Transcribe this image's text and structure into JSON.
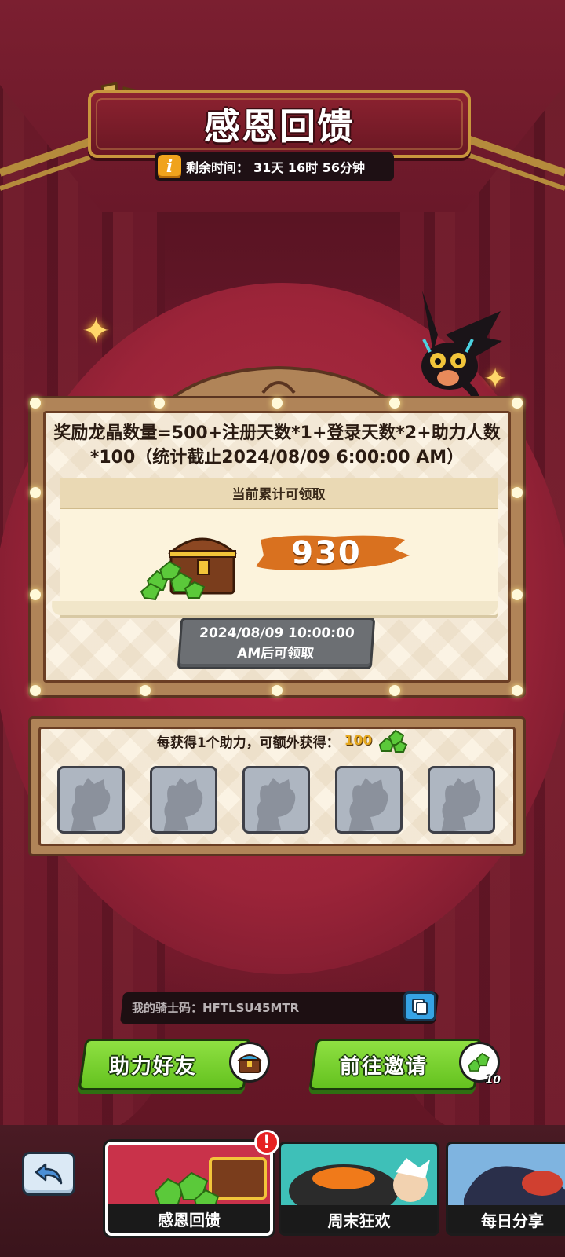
{
  "header": {
    "title": "感恩回馈",
    "timer_label": "剩余时间：",
    "timer_value": "31天 16时 56分钟"
  },
  "reward": {
    "formula": "奖励龙晶数量=500+注册天数*1+登录天数*2+助力人数*100（统计截止2024/08/09 6:00:00 AM）",
    "panel_title": "当前累计可领取",
    "amount": "930",
    "claim_button": "2024/08/09 10:00:00 AM后可领取"
  },
  "helpers": {
    "description": "每获得1个助力，可额外获得：",
    "bonus": "100",
    "slots": [
      "empty",
      "empty",
      "empty",
      "empty",
      "empty"
    ]
  },
  "code": {
    "text": "我的骑士码：HFTLSU45MTR"
  },
  "actions": {
    "help_friend": "助力好友",
    "invite": "前往邀请",
    "invite_badge_count": "10"
  },
  "nav": {
    "tabs": [
      {
        "label": "感恩回馈",
        "active": true
      },
      {
        "label": "周末狂欢",
        "active": false
      },
      {
        "label": "每日分享",
        "active": false
      }
    ],
    "alert": "!"
  },
  "colors": {
    "accent_green": "#64c21f",
    "gold": "#c8963d",
    "amount_brush": "#d9711f",
    "background_red": "#8a1f33"
  },
  "icons": [
    "glass-icon",
    "info-icon",
    "sparkle-icon",
    "chest-icon",
    "gem-icon",
    "avatar-placeholder-icon",
    "copy-icon",
    "back-arrow-icon"
  ]
}
